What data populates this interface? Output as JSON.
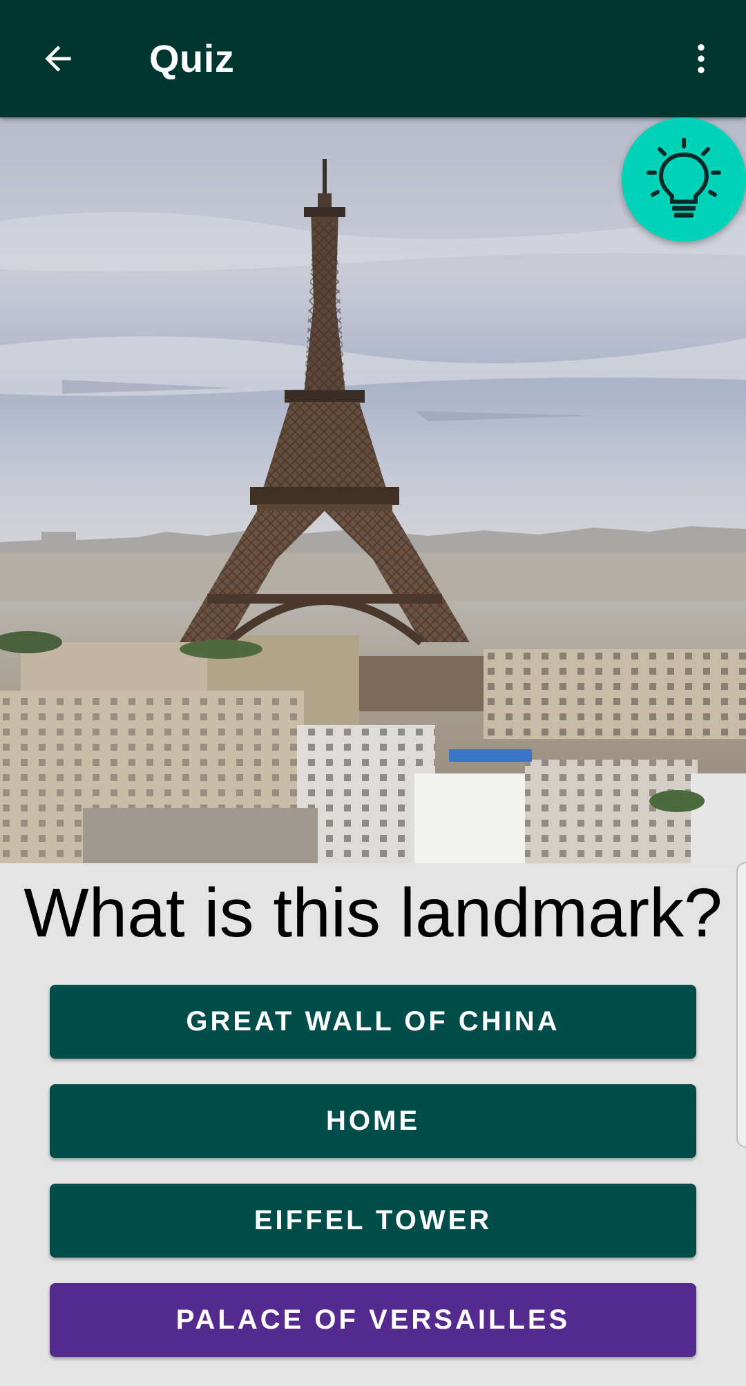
{
  "appbar": {
    "title": "Quiz",
    "background": "#003530",
    "back_icon": "arrow-back-icon",
    "menu_icon": "more-vert-icon"
  },
  "image": {
    "subject": "landmark-photo"
  },
  "hint_button": {
    "icon": "lightbulb-icon",
    "color": "#00d3b8"
  },
  "question": "What is this landmark?",
  "answers": [
    {
      "label": "GREAT WALL OF CHINA",
      "color": "#014d4a"
    },
    {
      "label": "HOME",
      "color": "#014d4a"
    },
    {
      "label": "EIFFEL TOWER",
      "color": "#014d4a"
    },
    {
      "label": "PALACE OF VERSAILLES",
      "color": "#552a8f"
    }
  ]
}
